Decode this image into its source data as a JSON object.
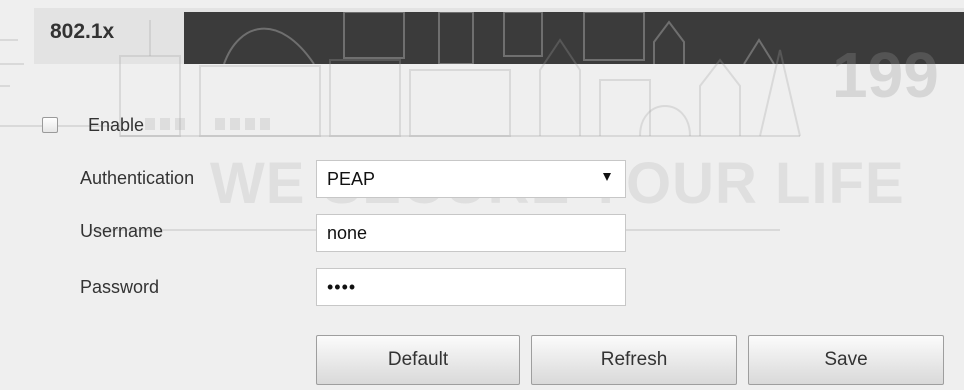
{
  "section": {
    "title": "802.1x"
  },
  "watermark": {
    "slogan": "WE SECURE YOUR LIFE",
    "number": "199"
  },
  "form": {
    "enable": {
      "label": "Enable",
      "checked": false
    },
    "authentication": {
      "label": "Authentication",
      "value": "PEAP"
    },
    "username": {
      "label": "Username",
      "value": "none"
    },
    "password": {
      "label": "Password",
      "value": "••••"
    }
  },
  "buttons": {
    "default_label": "Default",
    "refresh_label": "Refresh",
    "save_label": "Save"
  },
  "colors": {
    "background": "#efefef",
    "header_dark": "#3b3b3b",
    "field_bg": "#ffffff"
  }
}
